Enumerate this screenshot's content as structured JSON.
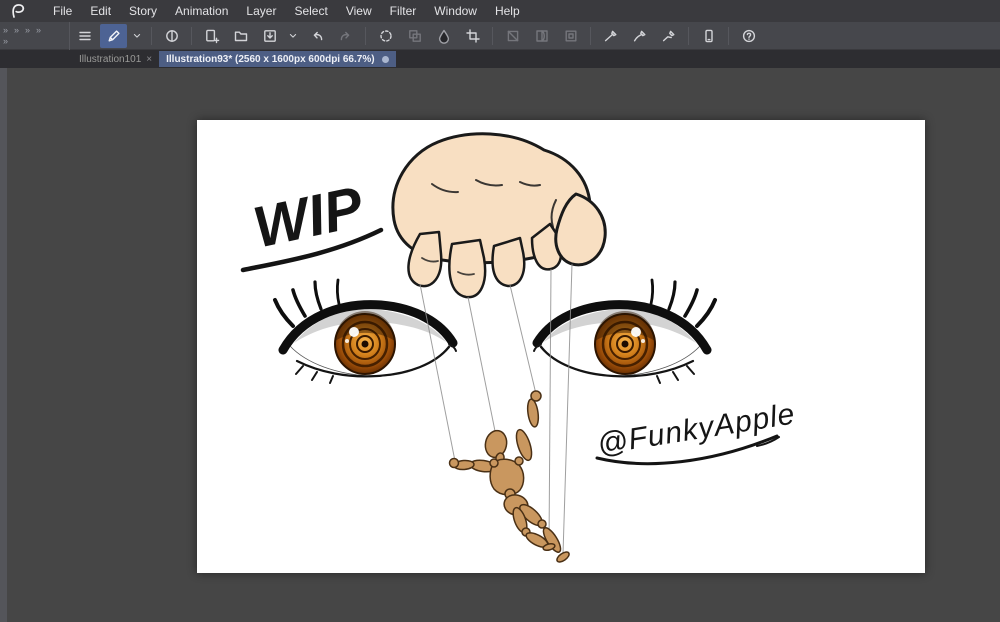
{
  "app": {
    "name": "Clip Studio Paint"
  },
  "menu": {
    "items": [
      "File",
      "Edit",
      "Story",
      "Animation",
      "Layer",
      "Select",
      "View",
      "Filter",
      "Window",
      "Help"
    ]
  },
  "panel_toggles": {
    "collapsed_chevron": "»"
  },
  "toolbar": {
    "active_tool": "pen-tool",
    "icons": [
      "main-menu",
      "pen-tool",
      "tool-dropdown",
      "symmetry-ruler",
      "new-canvas",
      "open-file",
      "export",
      "export-dropdown",
      "undo",
      "redo",
      "refresh",
      "duplicate",
      "fill",
      "crop",
      "transform",
      "mask",
      "frame",
      "stroke-line",
      "stroke-curve",
      "stroke-edit",
      "companion-device",
      "help"
    ]
  },
  "tabs": [
    {
      "title": "Illustration101",
      "close": "×",
      "active": false
    },
    {
      "title": "Illustration93* (2560 x 1600px 600dpi 66.7%)",
      "active": true
    }
  ],
  "canvas": {
    "wip": "WIP",
    "signature": "@FunkyApple"
  },
  "colors": {
    "tab_active": "#4d5e84",
    "tool_active": "#4d6394",
    "toolbar_bg": "#46474c",
    "canvas_area": "#464646",
    "skin": "#f8dfc2",
    "iris_amber": "#c97a1a",
    "mannequin_wood": "#c9975f"
  }
}
